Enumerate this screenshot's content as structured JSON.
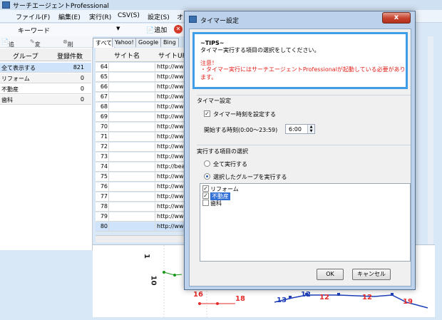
{
  "app": {
    "title": "サーチエージェントProfessional"
  },
  "menu": [
    "ファイル(F)",
    "編集(E)",
    "実行(R)",
    "CSV(S)",
    "設定(S)",
    "オ"
  ],
  "keyword_bar": {
    "label": "キーワード",
    "add_label": "追加"
  },
  "left_toolbar": {
    "add": "追加",
    "edit": "変更",
    "delete": "削除"
  },
  "group_table": {
    "headers": [
      "グループ",
      "登録件数"
    ],
    "rows": [
      {
        "name": "全て表示する",
        "count": "821"
      },
      {
        "name": "リフォーム",
        "count": "0"
      },
      {
        "name": "不動産",
        "count": "0"
      },
      {
        "name": "歯科",
        "count": "0"
      }
    ]
  },
  "site_tabs": [
    "すべて",
    "Yahoo!",
    "Google",
    "Bing"
  ],
  "site_table": {
    "headers": [
      "サイト名",
      "サイトURL"
    ],
    "rows": [
      {
        "num": "64",
        "url": "http://www"
      },
      {
        "num": "65",
        "url": "http://www"
      },
      {
        "num": "66",
        "url": "http://www"
      },
      {
        "num": "67",
        "url": "http://www"
      },
      {
        "num": "68",
        "url": "http://www"
      },
      {
        "num": "69",
        "url": "http://www"
      },
      {
        "num": "70",
        "url": "http://www"
      },
      {
        "num": "71",
        "url": "http://www"
      },
      {
        "num": "72",
        "url": "http://www"
      },
      {
        "num": "73",
        "url": "http://www"
      },
      {
        "num": "74",
        "url": "http://beau"
      },
      {
        "num": "75",
        "url": "http://www"
      },
      {
        "num": "76",
        "url": "http://www"
      },
      {
        "num": "77",
        "url": "http://www"
      },
      {
        "num": "78",
        "url": "http://www"
      },
      {
        "num": "79",
        "url": "http://www"
      },
      {
        "num": "80",
        "url": "http://www"
      }
    ]
  },
  "chart_labels": {
    "left_a": "10",
    "left_b": "1",
    "red_1": "16",
    "red_2": "18",
    "red_3": "12",
    "red_4": "12",
    "red_5": "19",
    "blue_1": "13",
    "blue_2": "12"
  },
  "dialog": {
    "title": "タイマー設定",
    "close": "x",
    "tips_title": "~TIPS~",
    "tips_desc": "タイマー実行する項目の選択をしてください。",
    "warn1": "注意！",
    "warn2": "・タイマー実行にはサーチエージェントProfessionalが起動している必要があります。",
    "timer_section": "タイマー設定",
    "timer_checkbox": "タイマー時刻を設定する",
    "start_time_label": "開始する時刻(0:00～23:59)",
    "start_time_value": "6:00",
    "exec_section": "実行する項目の選択",
    "radio_all": "全て実行する",
    "radio_selected": "選択したグループを実行する",
    "groups": [
      {
        "label": "リフォーム",
        "checked": "✓"
      },
      {
        "label": "不動産",
        "checked": "✓"
      },
      {
        "label": "歯科",
        "checked": ""
      }
    ],
    "ok": "OK",
    "cancel": "キャンセル"
  }
}
